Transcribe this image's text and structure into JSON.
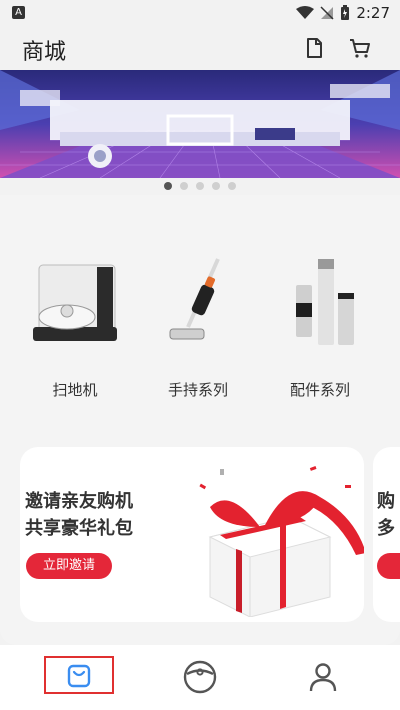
{
  "status": {
    "indicator": "A",
    "time": "2:27"
  },
  "header": {
    "title": "商城"
  },
  "carousel": {
    "slides": 5,
    "active": 0
  },
  "categories": [
    {
      "label": "扫地机"
    },
    {
      "label": "手持系列"
    },
    {
      "label": "配件系列"
    }
  ],
  "promo": {
    "line1": "邀请亲友购机",
    "line2": "共享豪华礼包",
    "button": "立即邀请"
  },
  "promo_next": {
    "line1": "购",
    "line2": "多"
  },
  "colors": {
    "accent": "#e42739",
    "background": "#f2f2f2"
  },
  "tabbar": {
    "items": [
      "shop-bag-icon",
      "robot-vacuum-icon",
      "profile-icon"
    ],
    "active": 0
  }
}
